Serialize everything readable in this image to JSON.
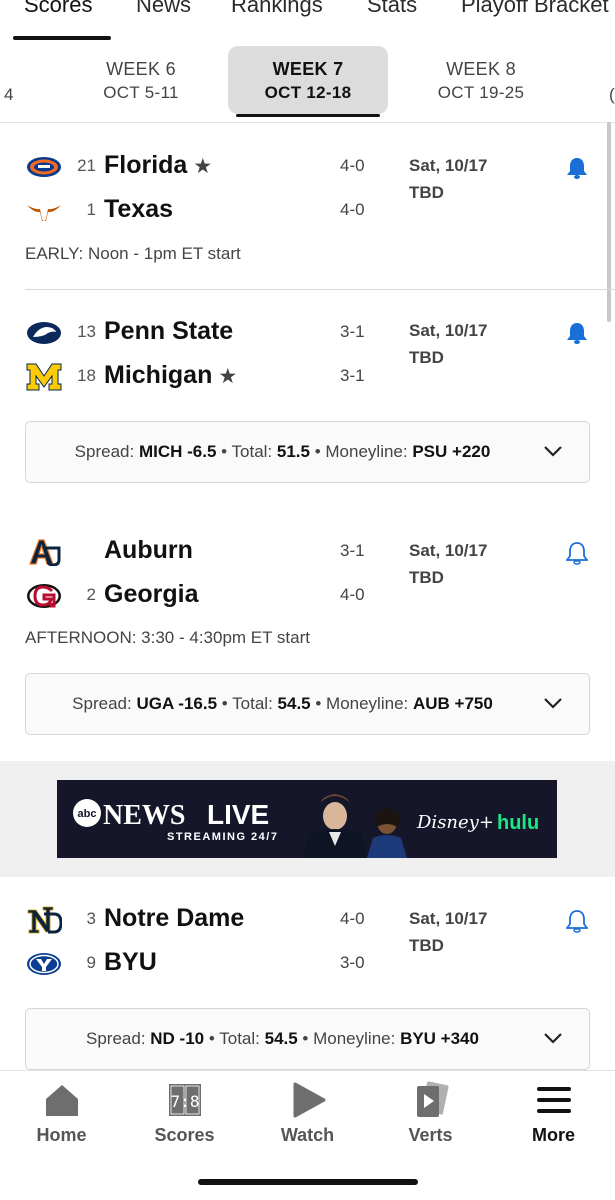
{
  "top_tabs": [
    "Scores",
    "News",
    "Rankings",
    "Stats",
    "Playoff Bracket"
  ],
  "weeks": {
    "prev_edge": "4",
    "items": [
      {
        "label": "WEEK 6",
        "dates": "OCT 5-11"
      },
      {
        "label": "WEEK 7",
        "dates": "OCT 12-18"
      },
      {
        "label": "WEEK 8",
        "dates": "OCT 19-25"
      }
    ],
    "next_edge": "("
  },
  "games": [
    {
      "teams": [
        {
          "rank": "21",
          "name": "Florida",
          "star": "★",
          "record": "4-0"
        },
        {
          "rank": "1",
          "name": "Texas",
          "star": "",
          "record": "4-0"
        }
      ],
      "date": "Sat, 10/17",
      "time": "TBD",
      "note": "EARLY: Noon - 1pm ET start"
    },
    {
      "teams": [
        {
          "rank": "13",
          "name": "Penn State",
          "star": "",
          "record": "3-1"
        },
        {
          "rank": "18",
          "name": "Michigan",
          "star": "★",
          "record": "3-1"
        }
      ],
      "date": "Sat, 10/17",
      "time": "TBD",
      "odds": {
        "spread_label": "Spread:",
        "spread": "MICH -6.5",
        "total_label": "Total:",
        "total": "51.5",
        "ml_label": "Moneyline:",
        "moneyline": "PSU +220"
      }
    },
    {
      "teams": [
        {
          "rank": "",
          "name": "Auburn",
          "star": "",
          "record": "3-1"
        },
        {
          "rank": "2",
          "name": "Georgia",
          "star": "",
          "record": "4-0"
        }
      ],
      "date": "Sat, 10/17",
      "time": "TBD",
      "note": "AFTERNOON: 3:30 - 4:30pm ET start",
      "odds": {
        "spread_label": "Spread:",
        "spread": "UGA -16.5",
        "total_label": "Total:",
        "total": "54.5",
        "ml_label": "Moneyline:",
        "moneyline": "AUB +750"
      }
    },
    {
      "teams": [
        {
          "rank": "3",
          "name": "Notre Dame",
          "star": "",
          "record": "4-0"
        },
        {
          "rank": "9",
          "name": "BYU",
          "star": "",
          "record": "3-0"
        }
      ],
      "date": "Sat, 10/17",
      "time": "TBD",
      "odds": {
        "spread_label": "Spread:",
        "spread": "ND -10",
        "total_label": "Total:",
        "total": "54.5",
        "ml_label": "Moneyline:",
        "moneyline": "BYU +340"
      }
    }
  ],
  "ad": {
    "brand": "abc",
    "news": "NEWS",
    "live": "LIVE",
    "streaming": "STREAMING 24/7",
    "disney": "Disney+",
    "hulu": "hulu"
  },
  "bottom_nav": [
    {
      "label": "Home",
      "icon": "home-icon"
    },
    {
      "label": "Scores",
      "icon": "scoreboard-icon",
      "icon_text": "7:8"
    },
    {
      "label": "Watch",
      "icon": "play-icon"
    },
    {
      "label": "Verts",
      "icon": "verts-icon"
    },
    {
      "label": "More",
      "icon": "menu-icon"
    }
  ],
  "colors": {
    "bell_filled": "#1a6fd6",
    "active_week_bg": "#dcdcdc",
    "ad_bg": "#15162a"
  }
}
